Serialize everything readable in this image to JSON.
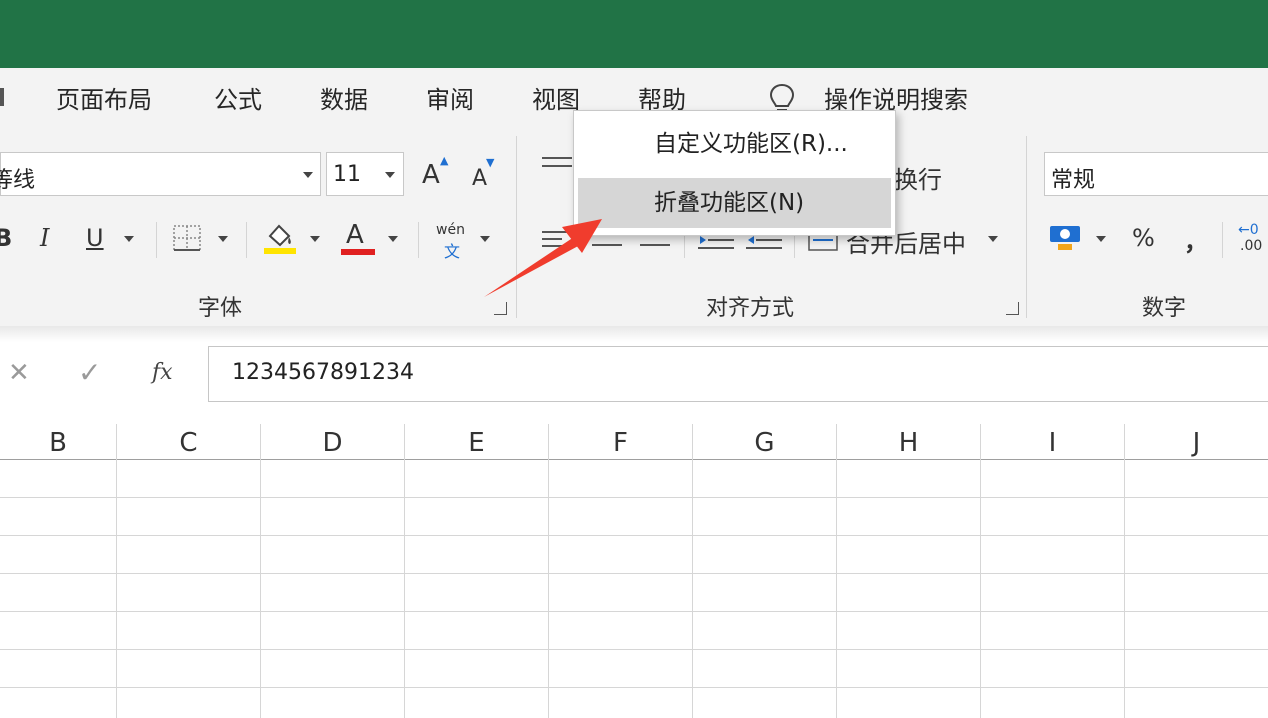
{
  "colors": {
    "title_bar": "#217346",
    "ribbon": "#f3f3f3",
    "highlight": "#d6d6d6",
    "arrow": "#f03c2d",
    "font_red": "#e02020",
    "fill_yellow": "#ffe400"
  },
  "menu_tabs": [
    "页面布局",
    "公式",
    "数据",
    "审阅",
    "视图",
    "帮助"
  ],
  "search_label": "操作说明搜索",
  "font": {
    "name_partial": "等线",
    "size": "11",
    "grow_label": "A",
    "shrink_label": "A",
    "bold": "B",
    "italic": "I",
    "underline": "U",
    "color_label": "A",
    "phonetic_top": "wén",
    "phonetic_bottom": "文",
    "group_label": "字体"
  },
  "alignment": {
    "wrap_partial": "换行",
    "merge_partial": "合并后居中",
    "group_label": "对齐方式"
  },
  "number": {
    "format": "常规",
    "percent": "%",
    "comma": "，",
    "decimal_top": "←0",
    "decimal_bottom": ".00",
    "group_label": "数字"
  },
  "formula_bar": {
    "cancel": "✕",
    "enter": "✓",
    "fx": "fx",
    "value": "1234567891234"
  },
  "columns": [
    "B",
    "C",
    "D",
    "E",
    "F",
    "G",
    "H",
    "I",
    "J"
  ],
  "context_menu": {
    "items": [
      "自定义功能区(R)...",
      "折叠功能区(N)"
    ],
    "highlighted_index": 1
  }
}
